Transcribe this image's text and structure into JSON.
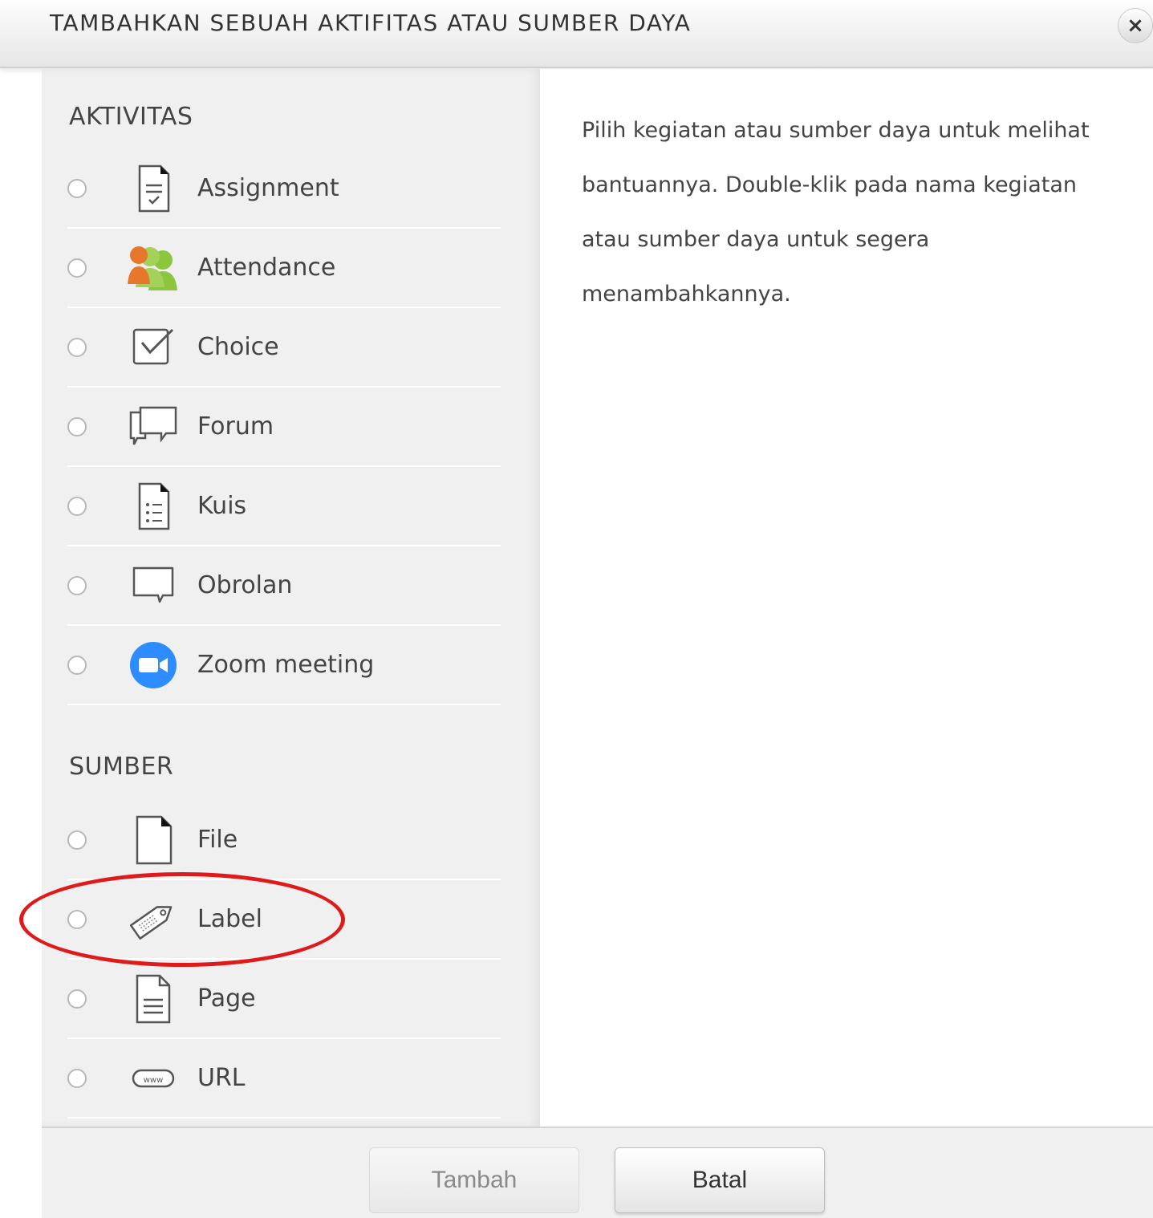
{
  "dialog": {
    "title": "TAMBAHKAN SEBUAH AKTIFITAS ATAU SUMBER DAYA",
    "close_label": "×"
  },
  "sections": {
    "activities": {
      "heading": "AKTIVITAS",
      "items": [
        {
          "label": "Assignment",
          "icon": "assignment-icon"
        },
        {
          "label": "Attendance",
          "icon": "attendance-icon"
        },
        {
          "label": "Choice",
          "icon": "choice-icon"
        },
        {
          "label": "Forum",
          "icon": "forum-icon"
        },
        {
          "label": "Kuis",
          "icon": "quiz-icon"
        },
        {
          "label": "Obrolan",
          "icon": "chat-icon"
        },
        {
          "label": "Zoom meeting",
          "icon": "zoom-icon"
        }
      ]
    },
    "resources": {
      "heading": "SUMBER",
      "items": [
        {
          "label": "File",
          "icon": "file-icon"
        },
        {
          "label": "Label",
          "icon": "label-tag-icon",
          "highlighted": true
        },
        {
          "label": "Page",
          "icon": "page-icon"
        },
        {
          "label": "URL",
          "icon": "url-icon"
        }
      ]
    }
  },
  "help": {
    "text": "Pilih kegiatan atau sumber daya untuk melihat bantuannya. Double-klik pada nama kegiatan atau sumber daya untuk segera menambahkannya."
  },
  "footer": {
    "add_label": "Tambah",
    "cancel_label": "Batal"
  },
  "colors": {
    "highlight": "#e01a1a",
    "zoom_blue": "#2d8cff",
    "attendance_orange": "#e8772e",
    "attendance_green": "#8cc63f"
  }
}
